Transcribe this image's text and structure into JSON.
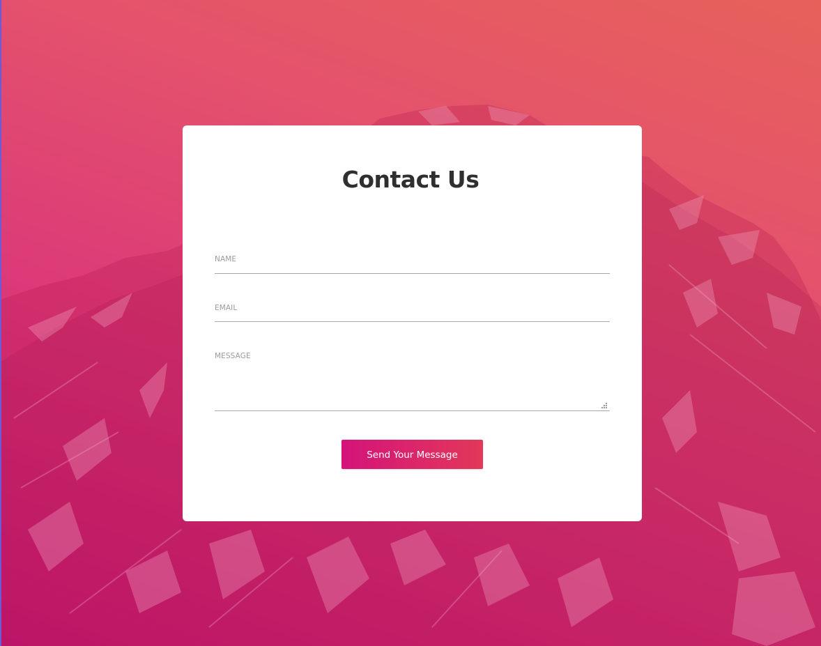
{
  "page": {
    "title": "Contact Us"
  },
  "form": {
    "name_label": "NAME",
    "email_label": "EMAIL",
    "message_label": "MESSAGE",
    "name_value": "",
    "email_value": "",
    "message_value": "",
    "submit_label": "Send Your Message"
  },
  "theme": {
    "gradient_start": "#c8177a",
    "gradient_end": "#e7615a",
    "button_start": "#d4137a",
    "button_end": "#e2385a",
    "card_background": "#ffffff",
    "title_color": "#2f2f2f"
  },
  "background": {
    "image": "snowy-mountain-photo"
  }
}
